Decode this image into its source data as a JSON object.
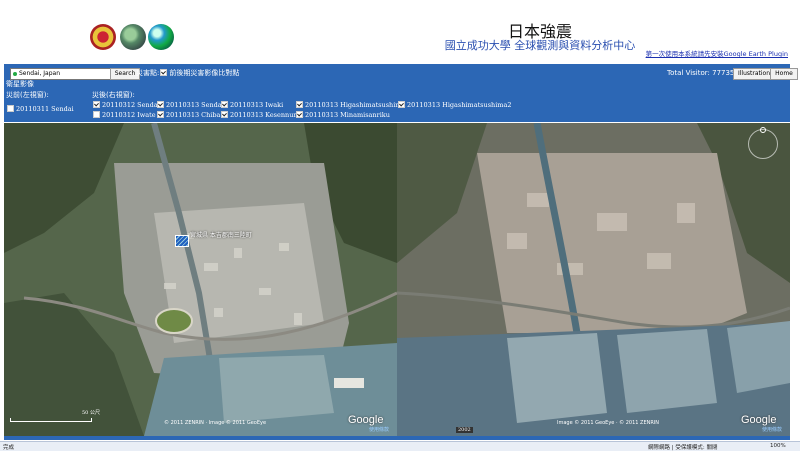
{
  "header": {
    "title": "日本強震",
    "subtitle": "國立成功大學 全球觀測與資料分析中心",
    "plugin_link": "第一次使用本系統請先安裝Google Earth Plugin"
  },
  "toolbar": {
    "search_value": "Sendai, Japan",
    "search_button": "Search",
    "compare_prefix": "災害點:",
    "compare_label": "前後期災害影像比對點",
    "visitor_label": "Total Visitor: 77735",
    "illustration_button": "Illustration",
    "home_button": "Home",
    "satellite_label": "衛星影像",
    "before_label": "災前(左視窗):",
    "after_label": "災後(右視窗):",
    "before_options": [
      {
        "label": "20110311 Sendai",
        "checked": false
      }
    ],
    "after_options": [
      {
        "label": "20110312 Sendai",
        "checked": true
      },
      {
        "label": "20110313 Sendai",
        "checked": true
      },
      {
        "label": "20110313 Iwaki",
        "checked": true
      },
      {
        "label": "20110313 Higashimatsushima",
        "checked": true
      },
      {
        "label": "20110313 Higashimatsushima2",
        "checked": true
      },
      {
        "label": "20110312 Iwate",
        "checked": false
      },
      {
        "label": "20110313 Chiba",
        "checked": true
      },
      {
        "label": "20110313 Kesennuma",
        "checked": true
      },
      {
        "label": "20110313 Minamisanriku",
        "checked": true
      }
    ]
  },
  "maps": {
    "left": {
      "place_label": "宮城県 本吉郡南三陸町",
      "google": "Google",
      "copyright": "© 2011 ZENRIN · Image © 2011 GeoEye",
      "terms": "使用條款",
      "scale": "50 公尺"
    },
    "right": {
      "google": "Google",
      "copyright": "Image © 2011 GeoEye · © 2011 ZENRIN",
      "terms": "使用條款",
      "year": "2002"
    }
  },
  "status": {
    "left_text": "完成",
    "zone_text": "網際網路 | 受保護模式: 關閉",
    "zoom": "100%"
  }
}
